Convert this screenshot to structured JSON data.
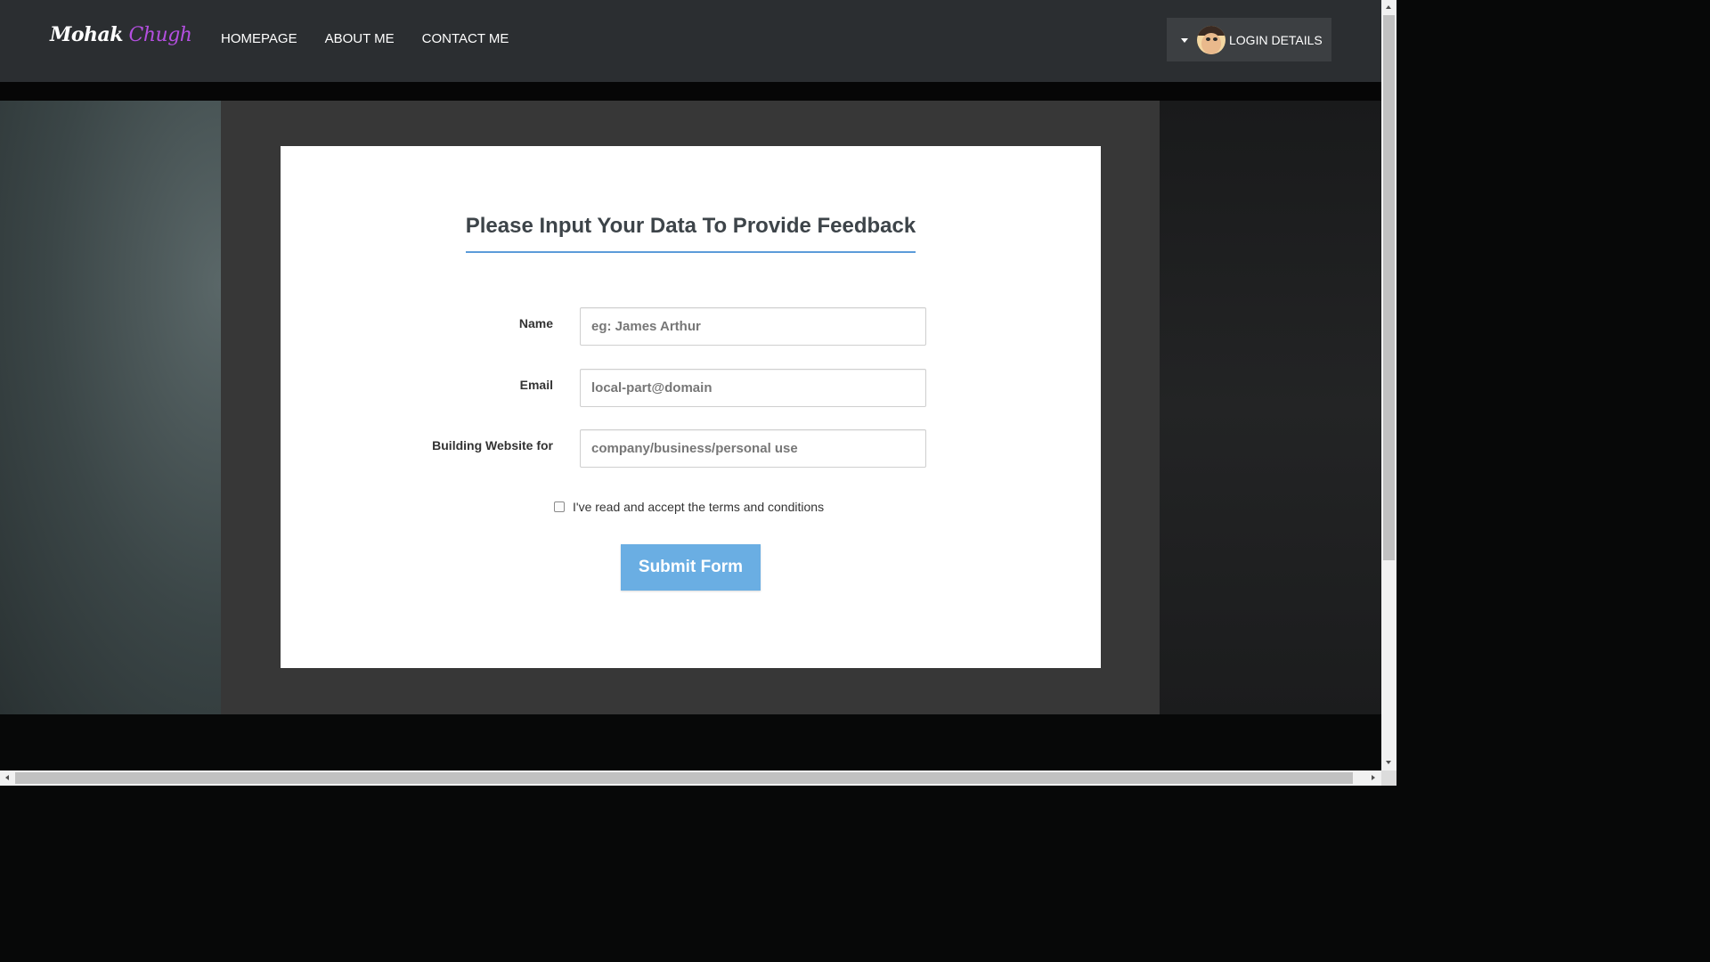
{
  "header": {
    "brand_first": "Mohak",
    "brand_last": "Chugh",
    "nav": [
      {
        "label": "HOMEPAGE"
      },
      {
        "label": "ABOUT ME"
      },
      {
        "label": "CONTACT ME"
      }
    ],
    "login_label": "LOGIN DETAILS"
  },
  "form": {
    "title": "Please Input Your Data To Provide Feedback",
    "fields": [
      {
        "label": "Name",
        "value": "",
        "placeholder": "eg: James Arthur"
      },
      {
        "label": "Email",
        "value": "",
        "placeholder": "local-part@domain"
      },
      {
        "label": "Building Website for",
        "value": "",
        "placeholder": "company/business/personal use"
      }
    ],
    "terms_label": "I've read and accept the terms and conditions",
    "terms_checked": false,
    "submit_label": "Submit Form"
  },
  "colors": {
    "navbar_bg": "#2b2e31",
    "brand_accent": "#b44fe0",
    "title_underline": "#5b9bd9",
    "submit_bg": "#6aaee3"
  },
  "icons": [
    "caret-down-icon",
    "user-avatar",
    "scroll-up-arrow-icon",
    "scroll-down-arrow-icon",
    "scroll-left-arrow-icon",
    "scroll-right-arrow-icon"
  ]
}
